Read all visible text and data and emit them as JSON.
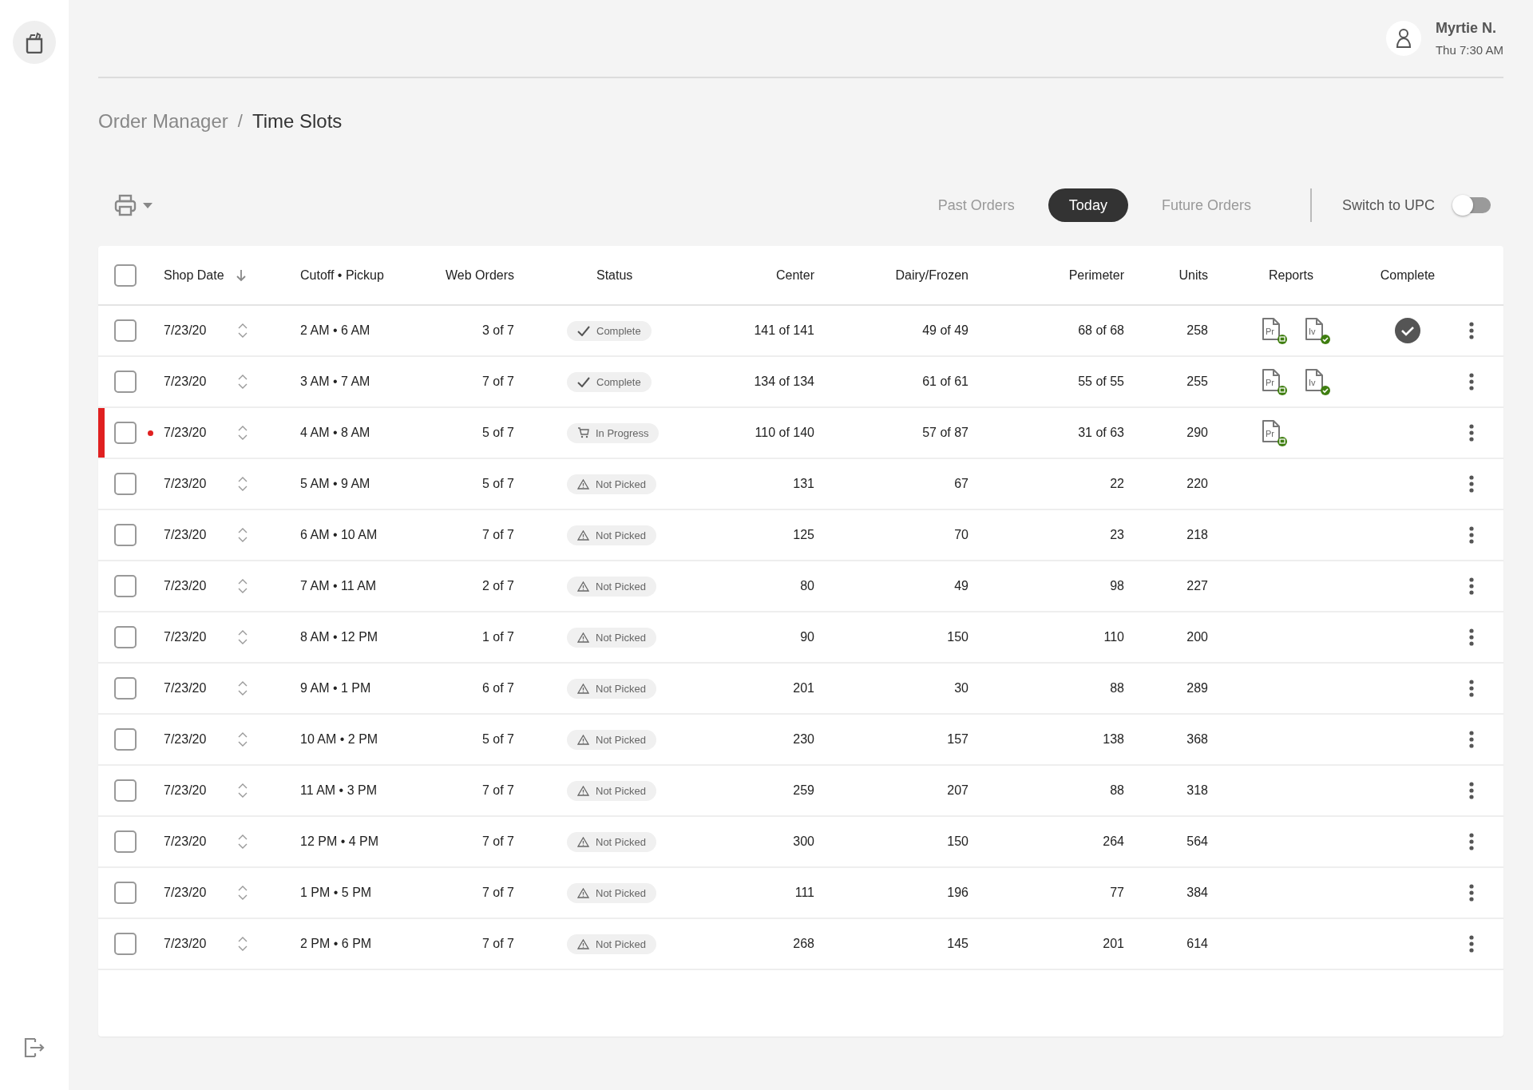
{
  "user": {
    "name": "Myrtie N.",
    "time": "Thu 7:30 AM"
  },
  "breadcrumb": [
    "Order Manager",
    "Time Slots"
  ],
  "breadcrumb_separator": "/",
  "tabs": [
    {
      "label": "Past Orders",
      "selected": false
    },
    {
      "label": "Today",
      "selected": true
    },
    {
      "label": "Future Orders",
      "selected": false
    }
  ],
  "upc_toggle": {
    "label": "Switch to UPC",
    "on": false
  },
  "table": {
    "columns": [
      "Shop Date",
      "Cutoff • Pickup",
      "Web Orders",
      "Status",
      "Center",
      "Dairy/Frozen",
      "Perimeter",
      "Units",
      "Reports",
      "Complete"
    ],
    "header_checked": false,
    "rows": [
      {
        "checked": false,
        "flagged": false,
        "date": "7/23/20",
        "slot": "2 AM • 6 AM",
        "web": "3 of 7",
        "status": {
          "kind": "complete",
          "label": "Complete"
        },
        "center": "141 of 141",
        "dairy": "49 of 49",
        "perimeter": "68 of 68",
        "units": "258",
        "reports": [
          {
            "kind": "printed",
            "label": "Pr"
          },
          {
            "kind": "done",
            "label": "Iv"
          }
        ],
        "complete": true
      },
      {
        "checked": false,
        "flagged": false,
        "date": "7/23/20",
        "slot": "3 AM • 7 AM",
        "web": "7 of 7",
        "status": {
          "kind": "complete",
          "label": "Complete"
        },
        "center": "134 of 134",
        "dairy": "61 of 61",
        "perimeter": "55 of 55",
        "units": "255",
        "reports": [
          {
            "kind": "printed",
            "label": "Pr"
          },
          {
            "kind": "done",
            "label": "Iv"
          }
        ],
        "complete": false
      },
      {
        "checked": false,
        "flagged": true,
        "date": "7/23/20",
        "slot": "4 AM • 8 AM",
        "web": "5 of 7",
        "status": {
          "kind": "in_progress",
          "label": "In Progress"
        },
        "center": "110 of 140",
        "dairy": "57 of 87",
        "perimeter": "31 of 63",
        "units": "290",
        "reports": [
          {
            "kind": "printed",
            "label": "Pr"
          }
        ],
        "complete": false
      },
      {
        "checked": false,
        "flagged": false,
        "date": "7/23/20",
        "slot": "5 AM • 9 AM",
        "web": "5 of 7",
        "status": {
          "kind": "not_picked",
          "label": "Not Picked"
        },
        "center": "131",
        "dairy": "67",
        "perimeter": "22",
        "units": "220",
        "reports": [],
        "complete": false
      },
      {
        "checked": false,
        "flagged": false,
        "date": "7/23/20",
        "slot": "6 AM • 10 AM",
        "web": "7 of 7",
        "status": {
          "kind": "not_picked",
          "label": "Not Picked"
        },
        "center": "125",
        "dairy": "70",
        "perimeter": "23",
        "units": "218",
        "reports": [],
        "complete": false
      },
      {
        "checked": false,
        "flagged": false,
        "date": "7/23/20",
        "slot": "7 AM • 11 AM",
        "web": "2 of 7",
        "status": {
          "kind": "not_picked",
          "label": "Not Picked"
        },
        "center": "80",
        "dairy": "49",
        "perimeter": "98",
        "units": "227",
        "reports": [],
        "complete": false
      },
      {
        "checked": false,
        "flagged": false,
        "date": "7/23/20",
        "slot": "8 AM • 12 PM",
        "web": "1 of 7",
        "status": {
          "kind": "not_picked",
          "label": "Not Picked"
        },
        "center": "90",
        "dairy": "150",
        "perimeter": "110",
        "units": "200",
        "reports": [],
        "complete": false
      },
      {
        "checked": false,
        "flagged": false,
        "date": "7/23/20",
        "slot": "9 AM • 1 PM",
        "web": "6 of 7",
        "status": {
          "kind": "not_picked",
          "label": "Not Picked"
        },
        "center": "201",
        "dairy": "30",
        "perimeter": "88",
        "units": "289",
        "reports": [],
        "complete": false
      },
      {
        "checked": false,
        "flagged": false,
        "date": "7/23/20",
        "slot": "10 AM • 2 PM",
        "web": "5 of 7",
        "status": {
          "kind": "not_picked",
          "label": "Not Picked"
        },
        "center": "230",
        "dairy": "157",
        "perimeter": "138",
        "units": "368",
        "reports": [],
        "complete": false
      },
      {
        "checked": false,
        "flagged": false,
        "date": "7/23/20",
        "slot": "11 AM • 3 PM",
        "web": "7 of 7",
        "status": {
          "kind": "not_picked",
          "label": "Not Picked"
        },
        "center": "259",
        "dairy": "207",
        "perimeter": "88",
        "units": "318",
        "reports": [],
        "complete": false
      },
      {
        "checked": false,
        "flagged": false,
        "date": "7/23/20",
        "slot": "12 PM • 4 PM",
        "web": "7 of 7",
        "status": {
          "kind": "not_picked",
          "label": "Not Picked"
        },
        "center": "300",
        "dairy": "150",
        "perimeter": "264",
        "units": "564",
        "reports": [],
        "complete": false
      },
      {
        "checked": false,
        "flagged": false,
        "date": "7/23/20",
        "slot": "1 PM • 5 PM",
        "web": "7 of 7",
        "status": {
          "kind": "not_picked",
          "label": "Not Picked"
        },
        "center": "111",
        "dairy": "196",
        "perimeter": "77",
        "units": "384",
        "reports": [],
        "complete": false
      },
      {
        "checked": false,
        "flagged": false,
        "date": "7/23/20",
        "slot": "2 PM • 6 PM",
        "web": "7 of 7",
        "status": {
          "kind": "not_picked",
          "label": "Not Picked"
        },
        "center": "268",
        "dairy": "145",
        "perimeter": "201",
        "units": "614",
        "reports": [],
        "complete": false
      }
    ]
  }
}
